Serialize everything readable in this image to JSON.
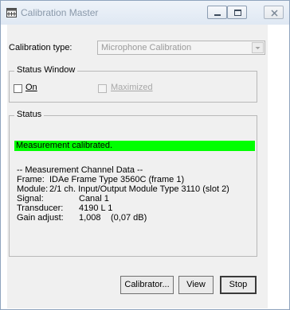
{
  "window": {
    "title": "Calibration Master"
  },
  "calibration": {
    "label": "Calibration type:",
    "selected": "Microphone Calibration"
  },
  "status_window": {
    "title": "Status Window",
    "on_label": "On",
    "on_checked": false,
    "maximized_label": "Maximized",
    "maximized_checked": false
  },
  "status": {
    "title": "Status",
    "message": "Measurement calibrated.",
    "message_color": "#00ff00",
    "section_header": "-- Measurement Channel Data --",
    "frame_label": "Frame:",
    "frame_value": "IDAe Frame Type 3560C (frame 1)",
    "module_label": "Module:",
    "module_value": "2/1 ch. Input/Output Module Type 3110 (slot 2)",
    "signal_label": "Signal:",
    "signal_value": "Canal 1",
    "transducer_label": "Transducer:",
    "transducer_value": "4190 L 1",
    "gain_label": "Gain adjust:",
    "gain_value": "1,008",
    "gain_db": "(0,07 dB)"
  },
  "buttons": {
    "calibrator": "Calibrator...",
    "view": "View",
    "stop": "Stop"
  }
}
